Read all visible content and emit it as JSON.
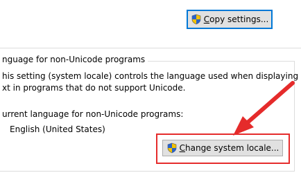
{
  "buttons": {
    "copy_settings": {
      "label_pre": "",
      "accel": "C",
      "label_post": "opy settings..."
    },
    "change_locale": {
      "label_pre": "",
      "accel": "C",
      "label_post": "hange system locale..."
    }
  },
  "non_unicode": {
    "group_title": "nguage for non-Unicode programs",
    "description_line1": "his setting (system locale) controls the language used when displaying",
    "description_line2": "xt in programs that do not support Unicode.",
    "current_label": "urrent language for non-Unicode programs:",
    "current_value": "English (United States)"
  },
  "annotation": {
    "color": "#e52b2b",
    "arrow_icon": "red-arrow-icon",
    "highlight": "highlight-box"
  },
  "icons": {
    "shield": "uac-shield-icon"
  }
}
